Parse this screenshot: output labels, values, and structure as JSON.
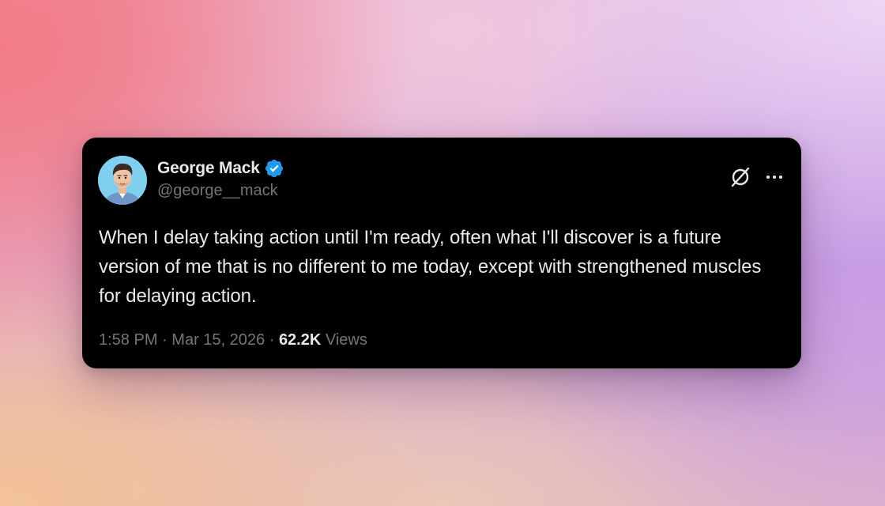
{
  "tweet": {
    "author": {
      "display_name": "George Mack",
      "handle": "@george__mack",
      "verified": true,
      "verified_color": "#1d9bf0",
      "avatar_icon": "cartoon-portrait-avatar"
    },
    "text": "When I delay taking action until I'm ready, often what I'll discover is a future version of me that is no different to me today, except with strengthened muscles for delaying action.",
    "time": "1:58 PM",
    "separator": "·",
    "date": "Mar 15, 2026",
    "views_count": "62.2K",
    "views_label": "Views"
  },
  "actions": {
    "x_icon": "x-logo-icon",
    "more_icon": "more-options-icon"
  },
  "colors": {
    "card_background": "#000000",
    "primary_text": "#e7e9ea",
    "secondary_text": "#71767b"
  }
}
